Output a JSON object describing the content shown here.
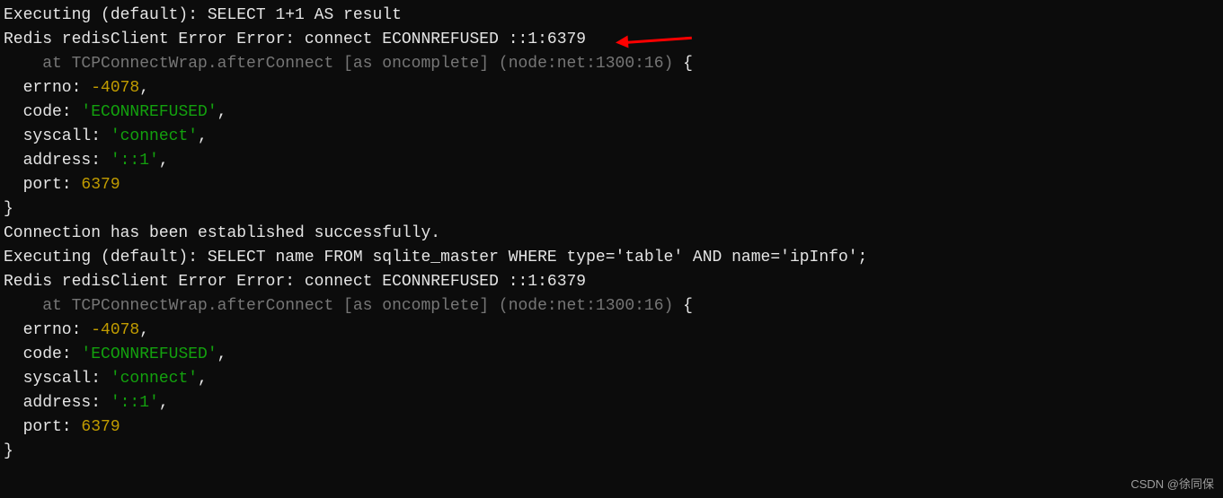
{
  "terminal": {
    "lines": [
      {
        "class": "white",
        "text": "Executing (default): SELECT 1+1 AS result"
      },
      {
        "class": "white",
        "text": "Redis redisClient Error Error: connect ECONNREFUSED ::1:6379"
      }
    ],
    "stack1": "    at TCPConnectWrap.afterConnect [as oncomplete] (node:net:1300:16) ",
    "brace_open": "{",
    "err1": {
      "errno_label": "  errno: ",
      "errno_val": "-4078",
      "comma": ",",
      "code_label": "  code: ",
      "code_val": "'ECONNREFUSED'",
      "syscall_label": "  syscall: ",
      "syscall_val": "'connect'",
      "address_label": "  address: ",
      "address_val": "'::1'",
      "port_label": "  port: ",
      "port_val": "6379"
    },
    "brace_close": "}",
    "line_conn": "Connection has been established successfully.",
    "line_sql": "Executing (default): SELECT name FROM sqlite_master WHERE type='table' AND name='ipInfo';",
    "line_redis2": "Redis redisClient Error Error: connect ECONNREFUSED ::1:6379",
    "stack2": "    at TCPConnectWrap.afterConnect [as oncomplete] (node:net:1300:16) ",
    "err2": {
      "errno_label": "  errno: ",
      "errno_val": "-4078",
      "comma": ",",
      "code_label": "  code: ",
      "code_val": "'ECONNREFUSED'",
      "syscall_label": "  syscall: ",
      "syscall_val": "'connect'",
      "address_label": "  address: ",
      "address_val": "'::1'",
      "port_label": "  port: ",
      "port_val": "6379"
    }
  },
  "watermark": "CSDN @徐同保"
}
